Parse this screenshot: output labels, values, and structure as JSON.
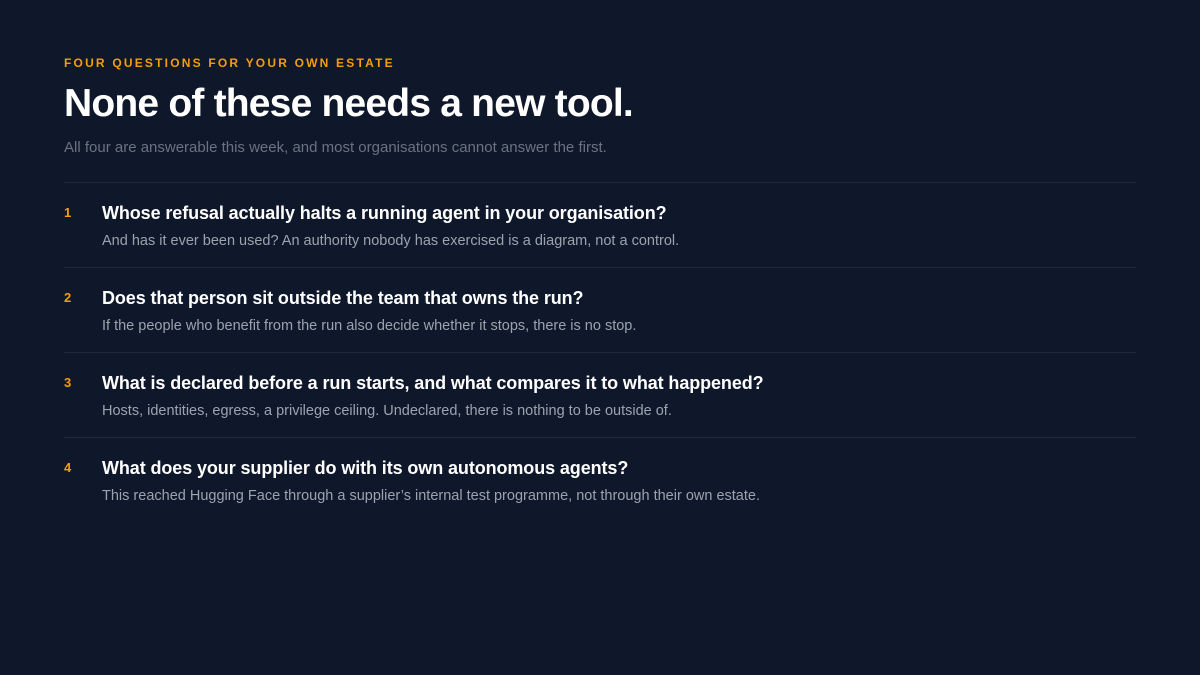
{
  "eyebrow": "FOUR QUESTIONS FOR YOUR OWN ESTATE",
  "title": "None of these needs a new tool.",
  "subtitle": "All four are answerable this week, and most organisations cannot answer the first.",
  "questions": [
    {
      "number": "1",
      "question": "Whose refusal actually halts a running agent in your organisation?",
      "note": "And has it ever been used? An authority nobody has exercised is a diagram, not a control."
    },
    {
      "number": "2",
      "question": "Does that person sit outside the team that owns the run?",
      "note": "If the people who benefit from the run also decide whether it stops, there is no stop."
    },
    {
      "number": "3",
      "question": "What is declared before a run starts, and what compares it to what happened?",
      "note": "Hosts, identities, egress, a privilege ceiling. Undeclared, there is nothing to be outside of."
    },
    {
      "number": "4",
      "question": "What does your supplier do with its own autonomous agents?",
      "note": "This reached Hugging Face through a supplier’s internal test programme, not through their own estate."
    }
  ],
  "colors": {
    "background": "#0f172a",
    "accent": "#f59e0b",
    "heading": "#ffffff",
    "muted": "#6b7280",
    "note": "#9ca3af",
    "divider": "#1f2937"
  }
}
